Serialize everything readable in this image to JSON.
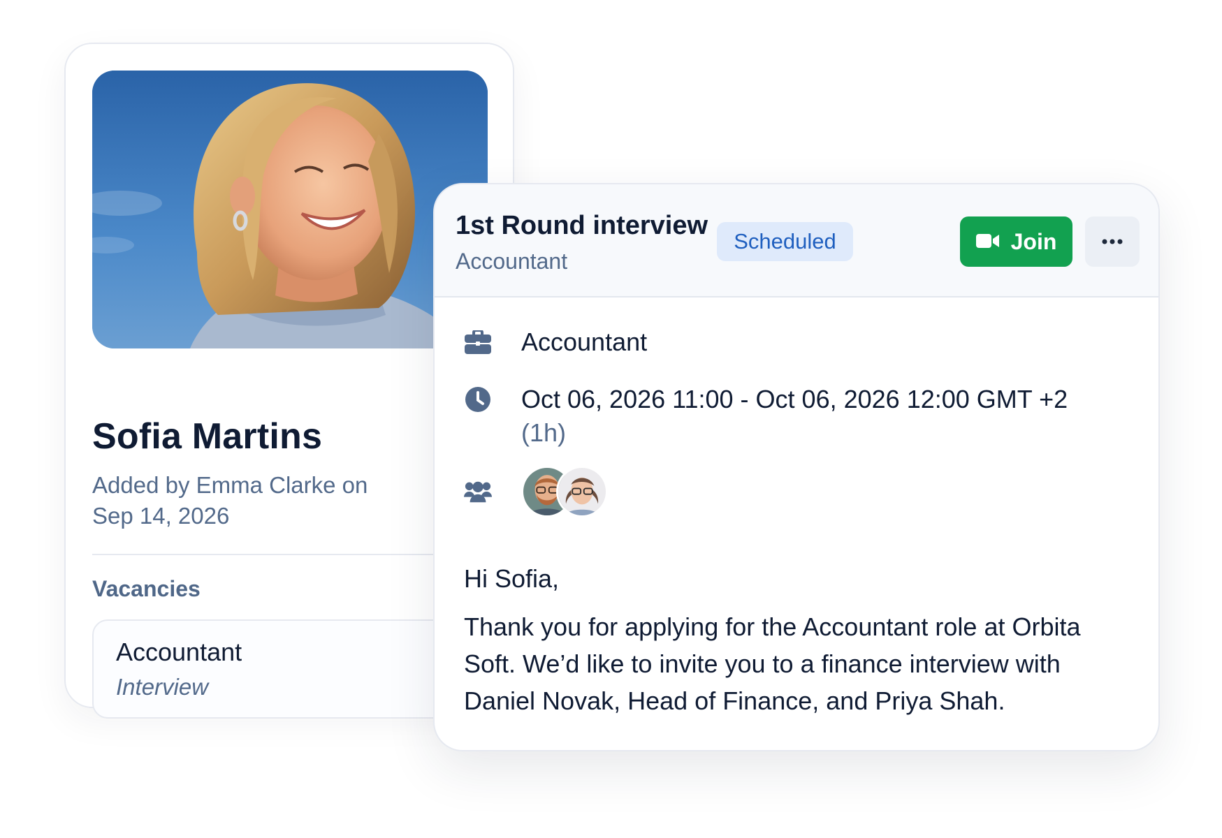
{
  "candidate": {
    "name": "Sofia Martins",
    "added_by": "Added by Emma Clarke on Sep 14, 2026",
    "vacancies_label": "Vacancies",
    "vacancy": {
      "title": "Accountant",
      "stage": "Interview"
    }
  },
  "interview": {
    "title": "1st Round interview",
    "subtitle": "Accountant",
    "status": "Scheduled",
    "join_label": "Join",
    "position": "Accountant",
    "time": "Oct 06, 2026 11:00 - Oct 06, 2026 12:00 GMT +2",
    "duration": "(1h)",
    "message": {
      "greeting": "Hi Sofia,",
      "body": "Thank you for applying for the Accountant role at Orbita Soft. We’d like to invite you to a finance interview with Daniel Novak, Head of Finance, and Priya Shah."
    }
  },
  "colors": {
    "accent_green": "#12a150",
    "badge_bg": "#dfeafb",
    "badge_text": "#1f5fbf",
    "muted_text": "#52698a"
  },
  "icons": {
    "position": "briefcase-icon",
    "time": "clock-icon",
    "attendees": "users-icon",
    "join": "video-camera-icon",
    "more": "ellipsis-icon"
  }
}
